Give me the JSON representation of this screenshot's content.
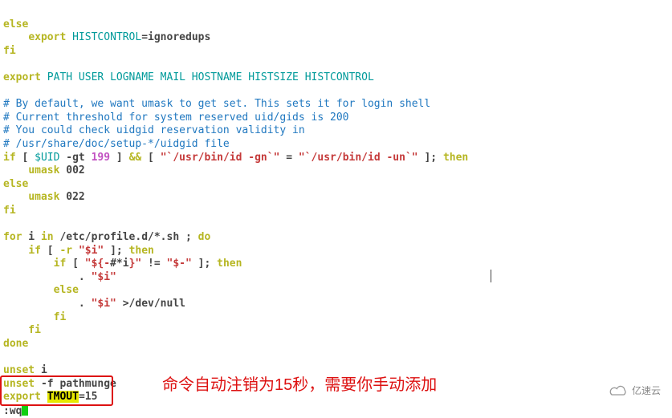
{
  "lines": {
    "l1a": "else",
    "l2a": "    ",
    "l2b": "export ",
    "l2c": "HISTCONTROL",
    "l2d": "=ignoredups",
    "l3": "fi",
    "l5a": "export ",
    "l5b": "PATH USER LOGNAME MAIL HOSTNAME HISTSIZE HISTCONTROL",
    "l7": "# By default, we want umask to get set. This sets it for login shell",
    "l8": "# Current threshold for system reserved uid/gids is 200",
    "l9": "# You could check uidgid reservation validity in",
    "l10": "# /usr/share/doc/setup-*/uidgid file",
    "l11a": "if",
    "l11b": " [ ",
    "l11c": "$UID",
    "l11d": " -gt ",
    "l11e": "199",
    "l11f": " ] ",
    "l11g": "&&",
    "l11h": " [ ",
    "l11i": "\"`/usr/bin/id -gn`\"",
    "l11j": " = ",
    "l11k": "\"`/usr/bin/id -un`\"",
    "l11l": " ]; ",
    "l11m": "then",
    "l12a": "    ",
    "l12b": "umask",
    "l12c": " 002",
    "l13": "else",
    "l14a": "    ",
    "l14b": "umask",
    "l14c": " 022",
    "l15": "fi",
    "l17a": "for",
    "l17b": " i ",
    "l17c": "in",
    "l17d": " /etc/profile.d/*.sh ; ",
    "l17e": "do",
    "l18a": "    ",
    "l18b": "if",
    "l18c": " [ ",
    "l18d": "-r",
    "l18e": " ",
    "l18f": "\"$i\"",
    "l18g": " ]; ",
    "l18h": "then",
    "l19a": "        ",
    "l19b": "if",
    "l19c": " [ ",
    "l19d": "\"${-",
    "l19e": "#*i",
    "l19f": "}\"",
    "l19g": " != ",
    "l19h": "\"$-\"",
    "l19i": " ]; ",
    "l19j": "then",
    "l20a": "            . ",
    "l20b": "\"$i\"",
    "l21a": "        ",
    "l21b": "else",
    "l22a": "            . ",
    "l22b": "\"$i\"",
    "l22c": " >/dev/null",
    "l23": "        fi",
    "l24": "    fi",
    "l25": "done",
    "l27a": "unset",
    "l27b": " i",
    "l28a": "unset",
    "l28b": " -f pathmunge",
    "l29a": "export ",
    "l29b": "TMOUT",
    "l29c": "=15",
    "l30": ":wq"
  },
  "annotation": "命令自动注销为15秒，需要你手动添加",
  "watermark": "亿速云",
  "icons": {
    "cloud": "cloud-icon"
  }
}
